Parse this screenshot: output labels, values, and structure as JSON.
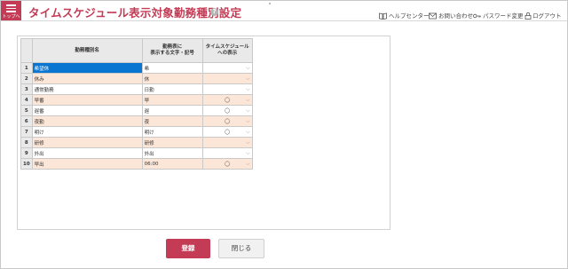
{
  "header": {
    "menu_label": "トップへ",
    "title": "タイムスケジュール表示対象勤務種別設定",
    "help_icon": "?"
  },
  "nav": {
    "help_center": "ヘルプセンター",
    "contact": "お問い合わせ",
    "password_change": "パスワード変更",
    "logout": "ログアウト"
  },
  "table": {
    "headers": {
      "num": "",
      "name": "勤務種別名",
      "display_line1": "勤務表に",
      "display_line2": "表示する文字・記号",
      "ts_line1": "タイムスケジュール",
      "ts_line2": "への表示"
    },
    "rows": [
      {
        "num": "1",
        "name": "希望休",
        "display": "希",
        "ts": ""
      },
      {
        "num": "2",
        "name": "休み",
        "display": "休",
        "ts": ""
      },
      {
        "num": "3",
        "name": "通常勤務",
        "display": "日勤",
        "ts": ""
      },
      {
        "num": "4",
        "name": "早番",
        "display": "早",
        "ts": "◯"
      },
      {
        "num": "5",
        "name": "遅番",
        "display": "遅",
        "ts": "◯"
      },
      {
        "num": "6",
        "name": "夜勤",
        "display": "夜",
        "ts": "◯"
      },
      {
        "num": "7",
        "name": "明け",
        "display": "明け",
        "ts": "◯"
      },
      {
        "num": "8",
        "name": "研修",
        "display": "研修",
        "ts": ""
      },
      {
        "num": "9",
        "name": "外出",
        "display": "外出",
        "ts": ""
      },
      {
        "num": "10",
        "name": "早出",
        "display": "06:00",
        "ts": "◯"
      }
    ]
  },
  "buttons": {
    "register": "登録",
    "close": "閉じる"
  },
  "colors": {
    "accent": "#c33b55",
    "row_alt": "#fbe6d7",
    "selected": "#0b76d1"
  }
}
